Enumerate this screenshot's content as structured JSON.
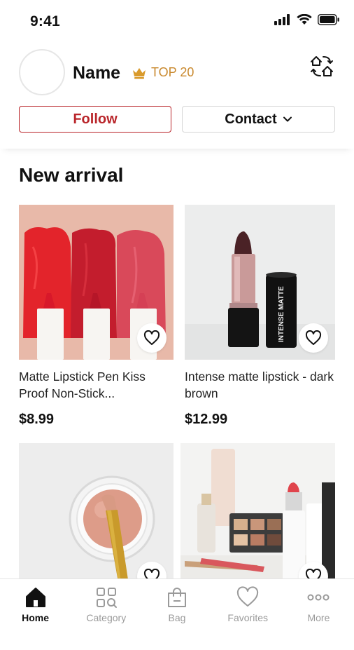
{
  "status_bar": {
    "time": "9:41"
  },
  "profile": {
    "name": "Name",
    "badge": "TOP 20",
    "follow_label": "Follow",
    "contact_label": "Contact"
  },
  "section": {
    "title": "New arrival"
  },
  "products": [
    {
      "title": "Matte Lipstick Pen Kiss Proof Non-Stick...",
      "price": "$8.99",
      "image": "red-lipstick-pens"
    },
    {
      "title": "Intense matte lipstick - dark brown",
      "price": "$12.99",
      "image": "dark-brown-lipstick",
      "package_text": "INTENSE MATTE"
    },
    {
      "title": "",
      "price": "",
      "image": "powder-brush-jar"
    },
    {
      "title": "",
      "price": "",
      "image": "makeup-set"
    }
  ],
  "tabs": [
    {
      "label": "Home",
      "icon": "home-icon",
      "active": true
    },
    {
      "label": "Category",
      "icon": "category-icon",
      "active": false
    },
    {
      "label": "Bag",
      "icon": "bag-icon",
      "active": false
    },
    {
      "label": "Favorites",
      "icon": "heart-icon",
      "active": false
    },
    {
      "label": "More",
      "icon": "more-icon",
      "active": false
    }
  ],
  "colors": {
    "accent": "#b9252a",
    "badge": "#c9892e"
  }
}
